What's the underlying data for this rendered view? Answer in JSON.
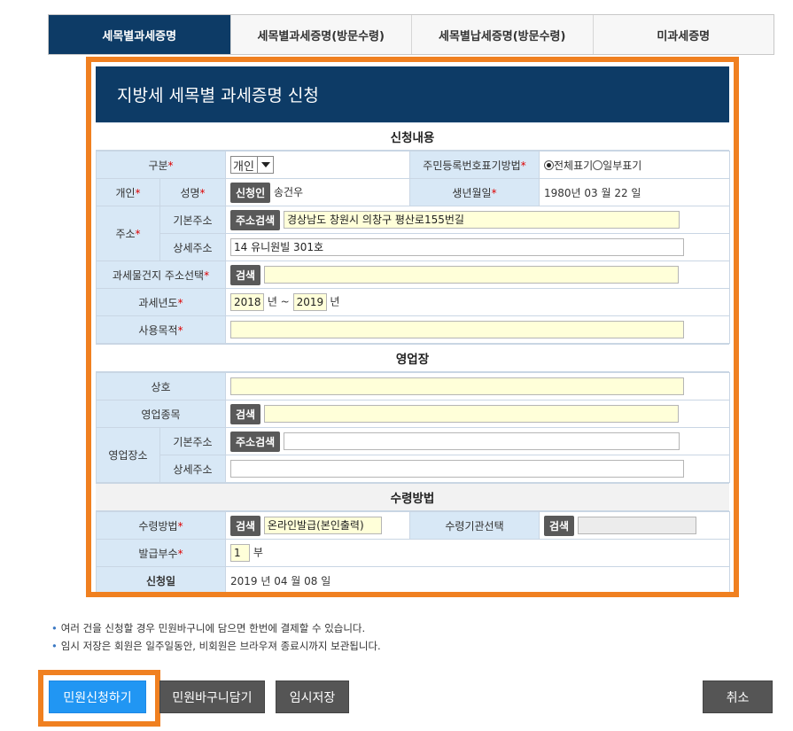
{
  "tabs": [
    "세목별과세증명",
    "세목별과세증명(방문수령)",
    "세목별납세증명(방문수령)",
    "미과세증명"
  ],
  "form_title": "지방세 세목별 과세증명 신청",
  "sections": {
    "apply": "신청내용",
    "business": "영업장",
    "receive": "수령방법"
  },
  "apply": {
    "gubun_label": "구분",
    "gubun_value": "개인",
    "rrn_label": "주민등록번호표기방법",
    "rrn_options": [
      "전체표기",
      "일부표기"
    ],
    "person_label": "개인",
    "name_label": "성명",
    "applicant_button": "신청인",
    "name_value": "송건우",
    "birth_label": "생년월일",
    "birth_value": "1980년 03 월 22 일",
    "address_label": "주소",
    "base_addr_label": "기본주소",
    "addr_search_button": "주소검색",
    "base_addr_value": "경상남도 창원시 의창구 평산로155번길",
    "detail_addr_label": "상세주소",
    "detail_addr_value": "14 유니원빌 301호",
    "property_label": "과세물건지 주소선택",
    "search_button": "검색",
    "tax_year_label": "과세년도",
    "year_from": "2018",
    "year_to": "2019",
    "year_unit": "년",
    "year_sep": "년 ~",
    "purpose_label": "사용목적"
  },
  "business": {
    "trade_name_label": "상호",
    "type_label": "영업종목",
    "search_button": "검색",
    "place_label": "영업장소",
    "base_addr_label": "기본주소",
    "addr_search_button": "주소검색",
    "detail_addr_label": "상세주소"
  },
  "receive": {
    "method_label": "수령방법",
    "search_button": "검색",
    "method_value": "온라인발급(본인출력)",
    "agency_label": "수령기관선택",
    "copies_label": "발급부수",
    "copies_value": "1",
    "copies_unit": "부",
    "date_label": "신청일",
    "date_value": "2019  년 04  월 08  일"
  },
  "notes": [
    "여러 건을 신청할 경우 민원바구니에 담으면 한번에 결제할 수 있습니다.",
    "임시 저장은 회원은 일주일동안, 비회원은 브라우져 종료시까지 보관됩니다."
  ],
  "buttons": {
    "apply": "민원신청하기",
    "basket": "민원바구니담기",
    "temp_save": "임시저장",
    "cancel": "취소"
  },
  "colors": {
    "header_navy": "#0d3b66",
    "highlight_orange": "#f08020",
    "apply_button_blue": "#2196f3",
    "label_bg": "#d8e8f6",
    "required_red": "#dd0000"
  }
}
